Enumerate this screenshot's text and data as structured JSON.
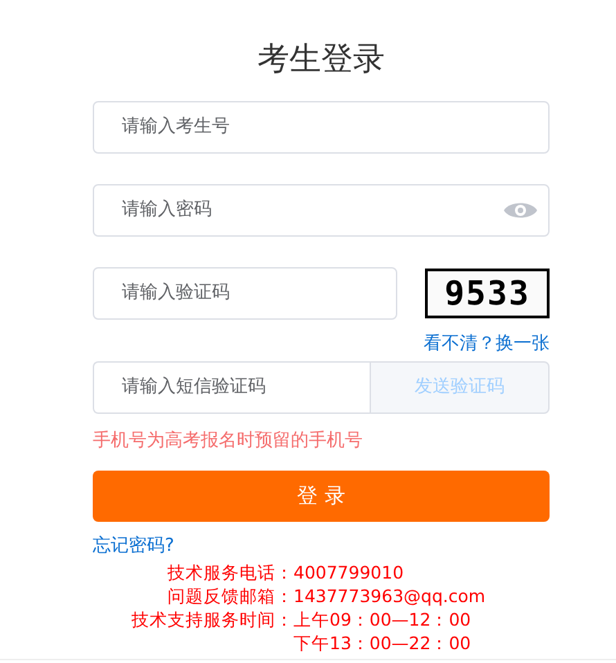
{
  "title": "考生登录",
  "fields": [
    {
      "kind": "text",
      "placeholder": "请输入考生号"
    },
    {
      "kind": "password",
      "placeholder": "请输入密码"
    },
    {
      "kind": "captcha",
      "placeholder": "请输入验证码",
      "captcha": "9533",
      "refresh_link": "看不清？换一张"
    },
    {
      "kind": "sms",
      "placeholder": "请输入短信验证码",
      "button": "发送验证码",
      "disabled": true
    }
  ],
  "hint": "手机号为高考报名时预留的手机号",
  "login_button": "登 录",
  "forgot_link": "忘记密码?",
  "contacts": [
    {
      "label": "技术服务电话：",
      "values": [
        "4007799010"
      ]
    },
    {
      "label": "问题反馈邮箱：",
      "values": [
        "1437773963@qq.com"
      ]
    },
    {
      "label": "技术支持服务时间：",
      "values": [
        "上午09：00—12：00",
        "下午13：00—22：00"
      ]
    }
  ]
}
